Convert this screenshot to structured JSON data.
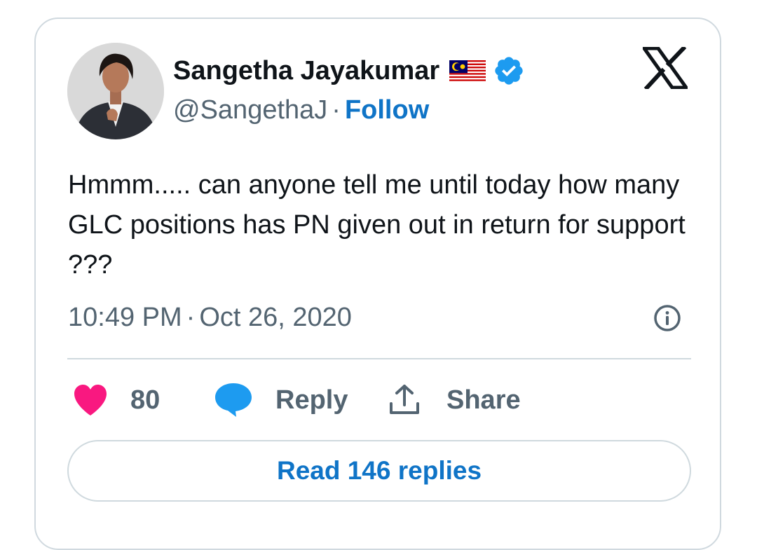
{
  "author": {
    "display_name": "Sangetha Jayakumar",
    "handle": "@SangethaJ",
    "separator": "·",
    "follow_label": "Follow",
    "flag_icon": "malaysia-flag-icon",
    "verified_icon": "verified-badge-icon"
  },
  "tweet": {
    "text": "Hmmm..... can anyone tell me until today how many GLC positions has PN given out in return for support ???",
    "time": "10:49 PM",
    "separator": "·",
    "date": "Oct 26, 2020"
  },
  "actions": {
    "like_count": "80",
    "reply_label": "Reply",
    "share_label": "Share"
  },
  "read_replies_label": "Read 146 replies",
  "colors": {
    "like": "#f91880",
    "reply": "#1d9bf0",
    "link": "#0f74c7",
    "verified": "#1d9bf0",
    "muted": "#536471",
    "border": "#cfd9de"
  }
}
